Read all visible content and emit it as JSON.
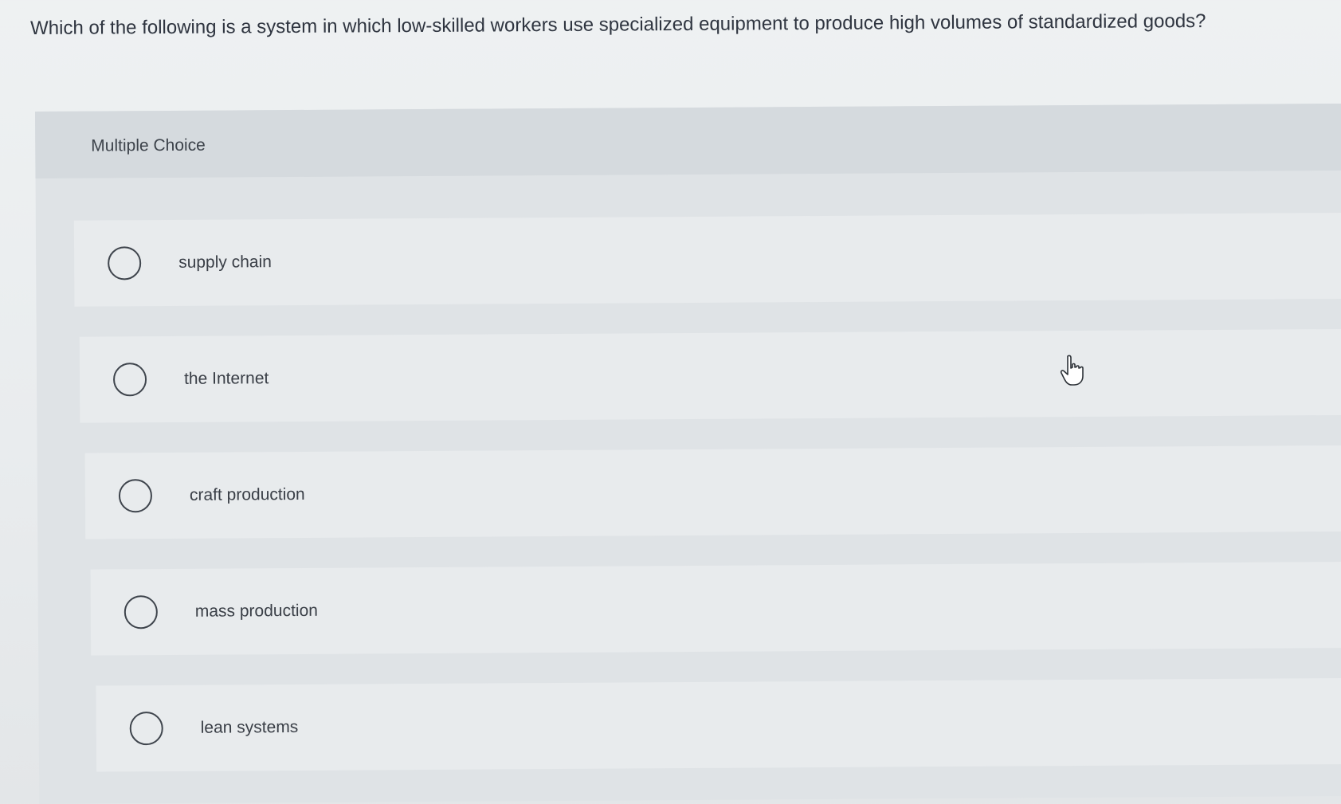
{
  "question": {
    "text": "Which of the following is a system in which low-skilled workers use specialized equipment to produce high volumes of standardized goods?"
  },
  "multiple_choice": {
    "title": "Multiple Choice",
    "options": [
      {
        "label": "supply chain",
        "selected": false
      },
      {
        "label": "the Internet",
        "selected": false
      },
      {
        "label": "craft production",
        "selected": false
      },
      {
        "label": "mass production",
        "selected": false
      },
      {
        "label": "lean systems",
        "selected": false
      }
    ]
  },
  "cursor": {
    "icon": "hand-pointer-icon"
  }
}
